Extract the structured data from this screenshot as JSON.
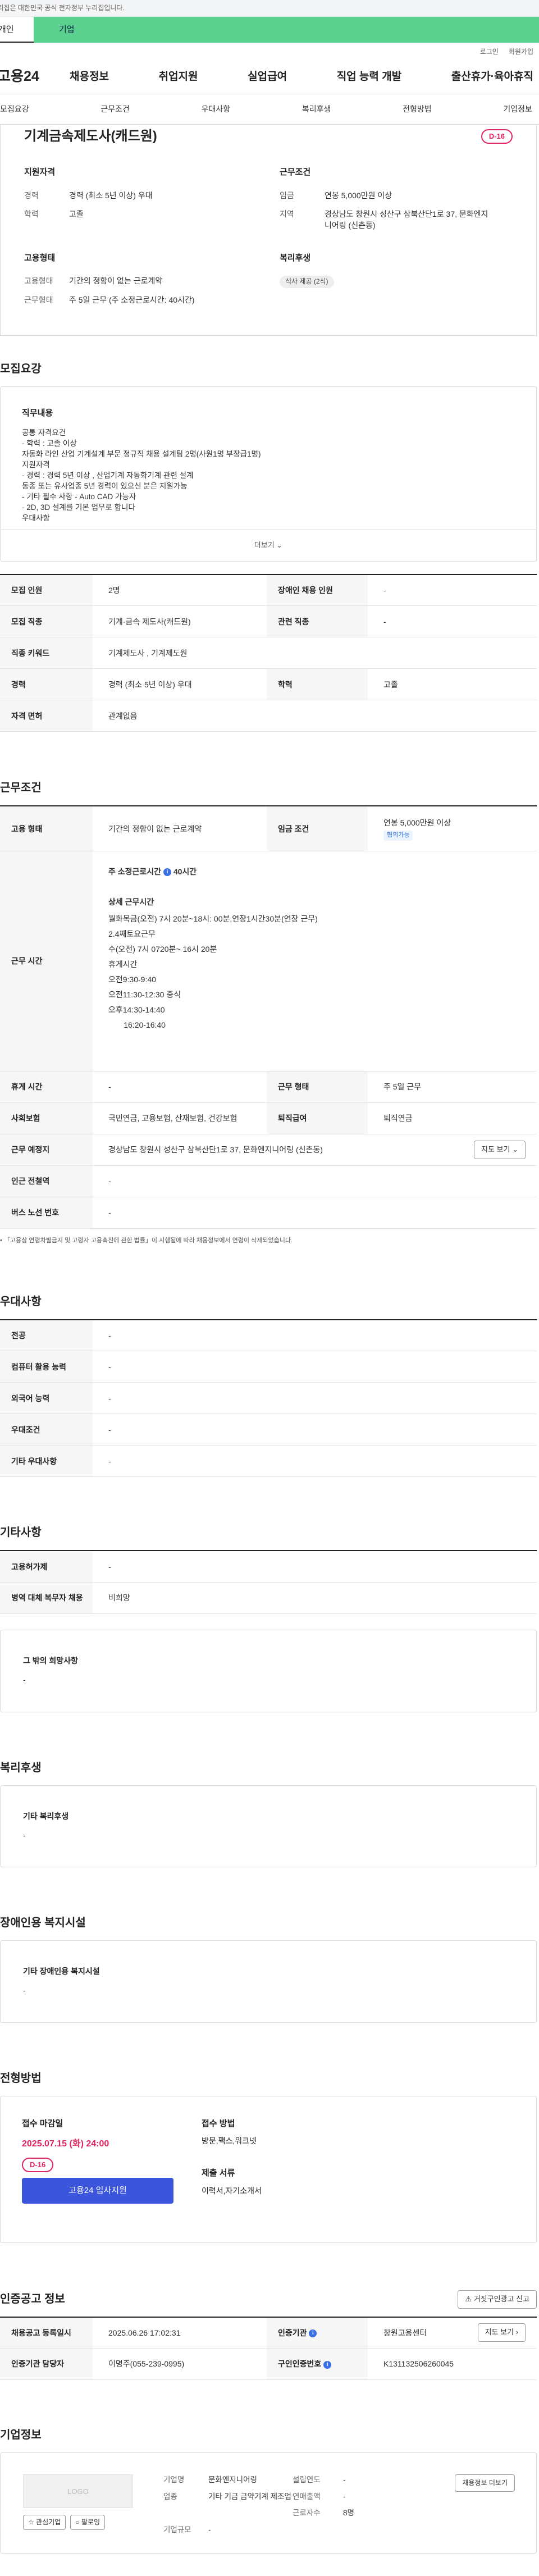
{
  "gov_notice": "이 누리집은 대한민국 공식 전자정부 누리집입니다.",
  "top_tabs": [
    "개인",
    "기업"
  ],
  "util_links": [
    "로그인",
    "회원가입"
  ],
  "logo": "고용24",
  "gnb": [
    "채용정보",
    "취업지원",
    "실업급여",
    "직업 능력 개발",
    "출산휴가·육아휴직"
  ],
  "snb": [
    "모집요강",
    "근무조건",
    "우대사항",
    "복리후생",
    "전형방법",
    "기업정보"
  ],
  "job": {
    "title": "기계금속제도사(캐드원)",
    "dday": "D-16",
    "qual_h": "지원자격",
    "qual": [
      {
        "k": "경력",
        "v": "경력 (최소 5년 이상) 우대"
      },
      {
        "k": "학력",
        "v": "고졸"
      }
    ],
    "cond_h": "근무조건",
    "cond": [
      {
        "k": "임금",
        "v": "연봉 5,000만원 이상"
      },
      {
        "k": "지역",
        "v": "경상남도 창원시 성산구 삼북산단1로 37, 문화엔지니어링 (신촌동)"
      }
    ],
    "type_h": "고용형태",
    "type": [
      {
        "k": "고용형태",
        "v": "기간의 정함이 없는 근로계약"
      },
      {
        "k": "근무형태",
        "v": "주 5일 근무 (주 소정근로시간: 40시간)"
      }
    ],
    "welfare_h": "복리후생",
    "welfare_chip": "식사 제공 (2식)"
  },
  "recruit": {
    "heading": "모집요강",
    "duty_h": "직무내용",
    "duty_lines": [
      "공통 자격요건",
      "- 학력 : 고졸 이상",
      "자동화 라인 산업 기계설계 부문 정규직 채용 설계팀 2명(사원1명 부장급1명)",
      "지원자격",
      "- 경력 : 경력 5년 이상 , 산업기계 자동화기계 관련 설계",
      "동종 또는 유사업종 5년 경력이 있으신 분은 지원가능",
      "- 기타 필수 사항 - Auto CAD 가능자",
      "- 2D, 3D 설계를 기본 업무로 합니다",
      "우대사항"
    ],
    "more": "더보기",
    "rows": [
      {
        "k1": "모집 인원",
        "v1": "2명",
        "k2": "장애인 채용 인원",
        "v2": "-"
      },
      {
        "k1": "모집 직종",
        "v1": "기계·금속 제도사(캐드원)",
        "k2": "관련 직종",
        "v2": "-"
      },
      {
        "k1": "직종 키워드",
        "v1": "기계제도사 , 기계제도원",
        "k2": "",
        "v2": ""
      },
      {
        "k1": "경력",
        "v1": "경력 (최소 5년 이상) 우대",
        "k2": "학력",
        "v2": "고졸"
      },
      {
        "k1": "자격 면허",
        "v1": "관계없음",
        "k2": "",
        "v2": ""
      }
    ]
  },
  "work": {
    "heading": "근무조건",
    "type_k": "고용 형태",
    "type_v": "기간의 정함이 없는 근로계약",
    "wage_k": "임금 조건",
    "wage_v": "연봉 5,000만원 이상",
    "wage_chip": "협의가능",
    "time_k": "근무 시간",
    "weekly": "주 소정근로시간",
    "weekly_v": "40시간",
    "detail_h": "상세 근무시간",
    "detail_lines": [
      "월화목금(오전) 7시 20분~18시: 00분,연장1시간30분(연장 근무)",
      "2.4째토요근무",
      "수(오전) 7시 0720분~ 16시 20분",
      "휴게시간",
      "오전9:30-9:40",
      "오전11:30-12:30 중식",
      "오후14:30-14:40",
      "       16:20-16:40"
    ],
    "rows": [
      {
        "k1": "휴게 시간",
        "v1": "-",
        "k2": "근무 형태",
        "v2": "주 5일 근무"
      },
      {
        "k1": "사회보험",
        "v1": "국민연금, 고용보험, 산재보험, 건강보험",
        "k2": "퇴직급여",
        "v2": "퇴직연금"
      }
    ],
    "place_k": "근무 예정지",
    "place_v": "경상남도 창원시 성산구 삼북산단1로 37, 문화엔지니어링 (신촌동)",
    "map_btn": "지도 보기",
    "station_k": "인근 전철역",
    "station_v": "-",
    "bus_k": "버스 노선 번호",
    "bus_v": "-",
    "note": "「고용상 연령차별금지 및 고령자 고용촉진에 관한 법률」이 시행됨에 따라 채용정보에서 연령이 삭제되었습니다."
  },
  "prefer": {
    "heading": "우대사항",
    "rows": [
      {
        "k": "전공",
        "v": "-"
      },
      {
        "k": "컴퓨터 활용 능력",
        "v": "-"
      },
      {
        "k": "외국어 능력",
        "v": "-"
      },
      {
        "k": "우대조건",
        "v": "-"
      },
      {
        "k": "기타 우대사항",
        "v": "-"
      }
    ]
  },
  "other": {
    "heading": "기타사항",
    "rows": [
      {
        "k": "고용허가제",
        "v": "-"
      },
      {
        "k": "병역 대체 복무자 채용",
        "v": "비희망"
      }
    ],
    "wish_h": "그 밖의 희망사항",
    "wish_v": "-"
  },
  "welfare": {
    "heading": "복리후생",
    "sub": "기타 복리후생",
    "v": "-"
  },
  "disabled": {
    "heading": "장애인용 복지시설",
    "sub": "기타 장애인용 복지시설",
    "v": "-"
  },
  "selection": {
    "heading": "전형방법",
    "deadline_h": "접수 마감일",
    "deadline_v": "2025.07.15 (화) 24:00",
    "dday": "D-16",
    "apply": "고용24 입사지원",
    "method_h": "접수 방법",
    "method_v": "방문,팩스,워크넷",
    "docs_h": "제출 서류",
    "docs_v": "이력서,자기소개서"
  },
  "cert": {
    "heading": "인증공고 정보",
    "report_btn": "거짓구인광고 신고",
    "rows": [
      {
        "k1": "채용공고 등록일시",
        "v1": "2025.06.26 17:02:31",
        "k2": "인증기관",
        "v2": "창원고용센터"
      },
      {
        "k1": "인증기관 담당자",
        "v1": "이명주(055-239-0995)",
        "k2": "구인인증번호",
        "v2": "K131132506260045"
      }
    ],
    "map_btn": "지도 보기"
  },
  "company": {
    "heading": "기업정보",
    "logo": "LOGO",
    "fav": "관심기업",
    "follow": "팔로잉",
    "name_k": "기업명",
    "name_v": "문화엔지니어링",
    "year_k": "설립연도",
    "year_v": "-",
    "more_btn": "채용정보 더보기",
    "biz_k": "업종",
    "biz_v": "기타 기금 금약기계 제조업",
    "sales_k": "연매출액",
    "sales_v": "-",
    "emp_k": "근로자수",
    "emp_v": "8명",
    "size_k": "기업규모",
    "size_v": "-"
  }
}
